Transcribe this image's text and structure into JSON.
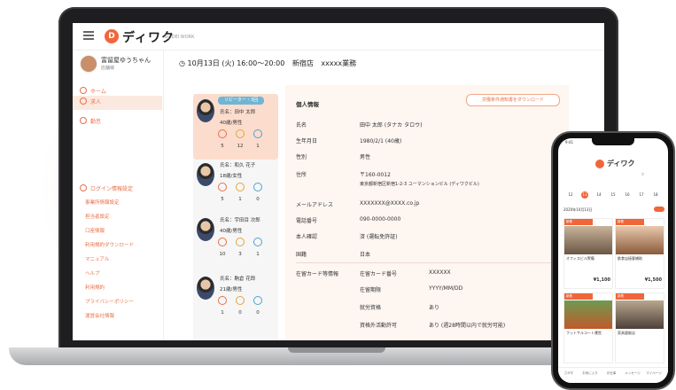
{
  "app": {
    "logo_text": "ディワク",
    "logo_sub": "by DEI WORK",
    "logo_initial": "D"
  },
  "sidebar": {
    "user_name": "富留屋ゆうちゃん",
    "user_role": "店舗様",
    "items": [
      {
        "label": "ホーム"
      },
      {
        "label": "求人"
      },
      {
        "label": "勤怠"
      }
    ],
    "subitems": [
      {
        "label": "ログイン情報設定"
      },
      {
        "label": "事業所情報設定"
      },
      {
        "label": "担当者設定"
      },
      {
        "label": "口座情報"
      },
      {
        "label": "利用規約ダウンロード"
      },
      {
        "label": "マニュアル"
      },
      {
        "label": "ヘルプ"
      },
      {
        "label": "利用規約"
      },
      {
        "label": "プライバシーポリシー"
      },
      {
        "label": "運営会社情報"
      }
    ]
  },
  "header": {
    "shift": "10月13日 (火) 16:00〜20:00",
    "store": "新宿店",
    "job": "xxxxx業務"
  },
  "candidates": [
    {
      "tag": "リピーター・3回",
      "name": "氏名：田中 太郎",
      "age": "40歳/男性",
      "counts": [
        "5",
        "12",
        "1"
      ]
    },
    {
      "tag": "",
      "name": "氏名：和久 花子",
      "age": "18歳/女性",
      "counts": [
        "5",
        "1",
        "0"
      ]
    },
    {
      "tag": "",
      "name": "氏名：宇田目 次郎",
      "age": "40歳/男性",
      "counts": [
        "10",
        "3",
        "1"
      ]
    },
    {
      "tag": "",
      "name": "氏名：駒倉 花郎",
      "age": "21歳/男性",
      "counts": [
        "1",
        "0",
        "0"
      ]
    }
  ],
  "detail": {
    "title": "個人情報",
    "button": "労働条件通知書をダウンロード",
    "rows": [
      {
        "label": "氏名",
        "value": "田中 太郎 (タナカ タロウ)"
      },
      {
        "label": "生年月日",
        "value": "1980/2/1 (40歳)"
      },
      {
        "label": "性別",
        "value": "男性"
      },
      {
        "label": "住所",
        "value": "〒160-0012"
      },
      {
        "label": "",
        "value": "東京都新宿区新宿1-2-3 ユーマンションビル (ディワクビル)"
      },
      {
        "label": "メールアドレス",
        "value": "XXXXXXX@XXXX.co.jp"
      },
      {
        "label": "電話番号",
        "value": "090-0000-0000"
      },
      {
        "label": "本人確認",
        "value": "済 (運転免許証)"
      },
      {
        "label": "国籍",
        "value": "日本"
      }
    ],
    "residence_label": "在留カード等情報",
    "residence_rows": [
      {
        "label": "在留カード番号",
        "value": "XXXXXX"
      },
      {
        "label": "在留期限",
        "value": "YYYY/MM/DD"
      },
      {
        "label": "就労資格",
        "value": "あり"
      },
      {
        "label": "資格外活動許可",
        "value": "あり (週28時間以内で就労可能)"
      }
    ]
  },
  "phone": {
    "time": "9:41",
    "logo_text": "ディワク",
    "date": "2020年10月13日",
    "days": [
      "12",
      "13",
      "14",
      "15",
      "16",
      "17",
      "18"
    ],
    "jobs": [
      {
        "tag": "新着",
        "title": "オフィスビル警備",
        "price": "¥1,100"
      },
      {
        "tag": "新着",
        "title": "飲食店接客補助",
        "price": "¥1,500"
      },
      {
        "tag": "新着",
        "title": "フットサルコート運営",
        "price": ""
      },
      {
        "tag": "新着",
        "title": "家具量販店",
        "price": ""
      }
    ],
    "tabs": [
      "さがす",
      "お気に入り",
      "お仕事",
      "メッセージ",
      "マイページ"
    ]
  },
  "colors": {
    "accent": "#f0663a",
    "tag_blue": "#6fb6d4"
  }
}
